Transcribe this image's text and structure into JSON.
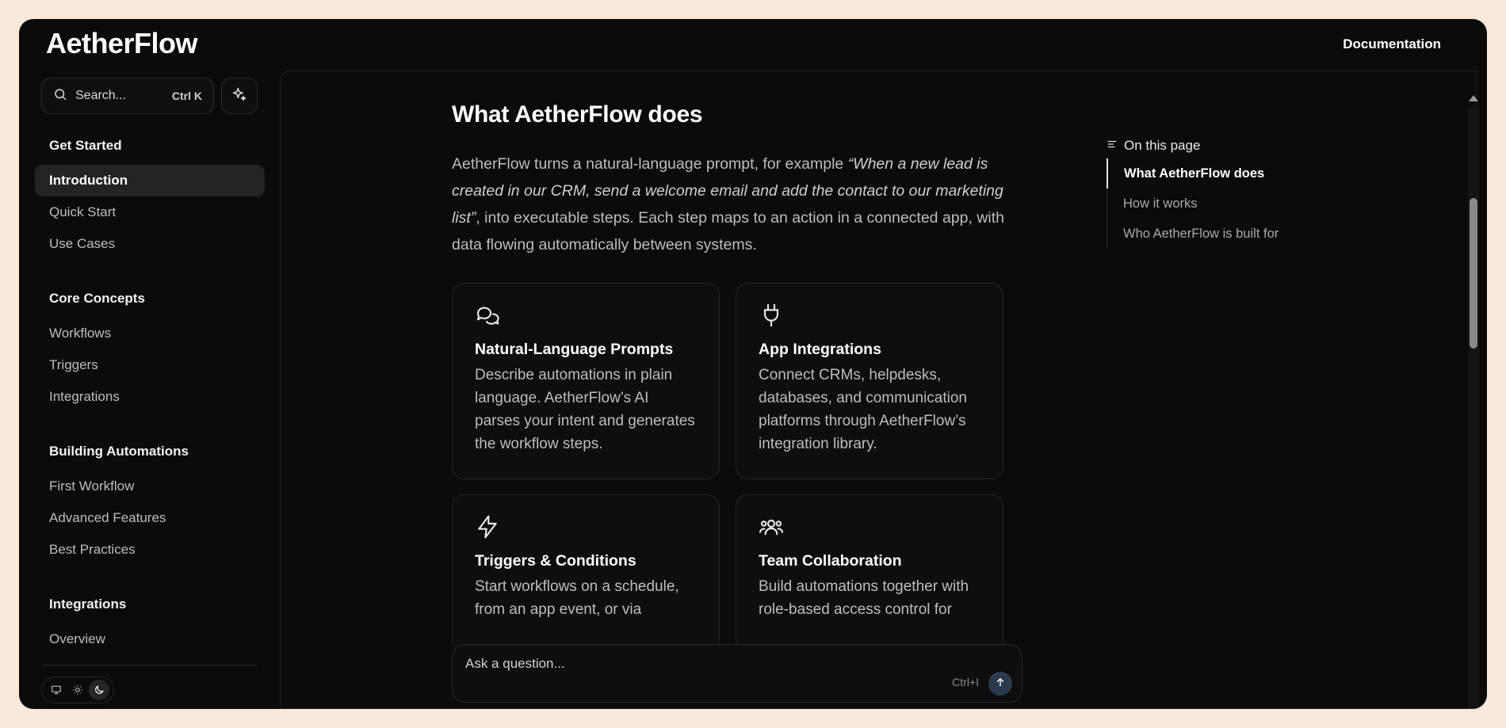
{
  "header": {
    "logo": "AetherFlow",
    "doc_link": "Documentation"
  },
  "sidebar": {
    "search_label": "Search...",
    "search_shortcut": "Ctrl K",
    "sections": [
      {
        "heading": "Get Started",
        "items": [
          "Introduction",
          "Quick Start",
          "Use Cases"
        ]
      },
      {
        "heading": "Core Concepts",
        "items": [
          "Workflows",
          "Triggers",
          "Integrations"
        ]
      },
      {
        "heading": "Building Automations",
        "items": [
          "First Workflow",
          "Advanced Features",
          "Best Practices"
        ]
      },
      {
        "heading": "Integrations",
        "items": [
          "Overview"
        ]
      }
    ],
    "active_item": "Introduction",
    "theme": {
      "selected": "dark"
    }
  },
  "main": {
    "title": "What AetherFlow does",
    "intro_before": "AetherFlow turns a natural-language prompt, for example ",
    "intro_quote": "“When a new lead is created in our CRM, send a welcome email and add the contact to our marketing list”",
    "intro_after": ", into executable steps. Each step maps to an action in a connected app, with data flowing automatically between systems.",
    "cards": [
      {
        "icon": "chat-bubbles-icon",
        "title": "Natural-Language Prompts",
        "desc": "Describe automations in plain language. AetherFlow’s AI parses your intent and generates the workflow steps."
      },
      {
        "icon": "plug-icon",
        "title": "App Integrations",
        "desc": "Connect CRMs, helpdesks, databases, and communication platforms through AetherFlow’s integration library."
      },
      {
        "icon": "lightning-icon",
        "title": "Triggers & Conditions",
        "desc": "Start workflows on a schedule, from an app event, or via"
      },
      {
        "icon": "users-icon",
        "title": "Team Collaboration",
        "desc": "Build automations together with role-based access control for"
      }
    ]
  },
  "toc": {
    "heading": "On this page",
    "items": [
      "What AetherFlow does",
      "How it works",
      "Who AetherFlow is built for"
    ]
  },
  "ask": {
    "placeholder": "Ask a question...",
    "shortcut": "Ctrl+I"
  }
}
